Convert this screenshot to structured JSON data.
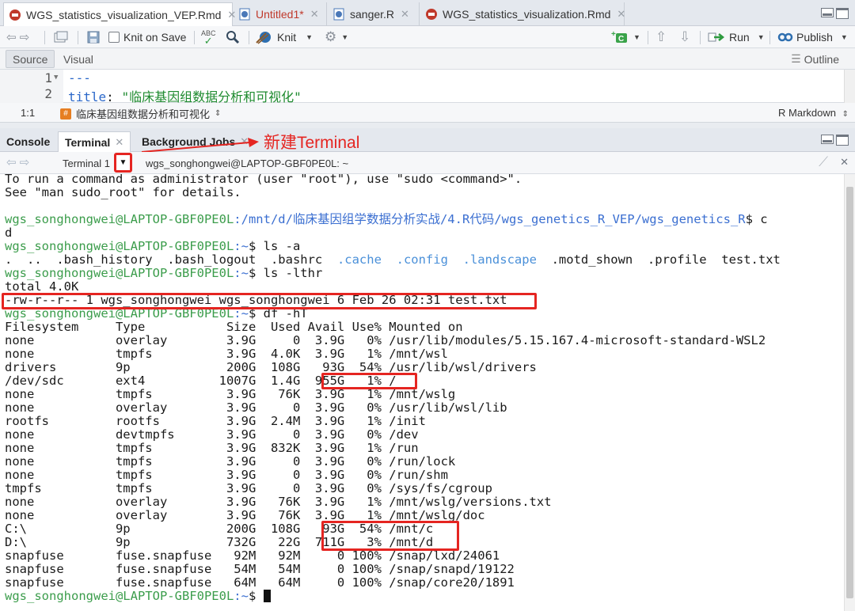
{
  "editor_tabs": [
    {
      "label": "WGS_statistics_visualization_VEP.Rmd",
      "icon": "rmd-file-icon",
      "active": true
    },
    {
      "label": "Untitled1*",
      "icon": "r-file-icon",
      "modified": true
    },
    {
      "label": "sanger.R",
      "icon": "r-file-icon"
    },
    {
      "label": "WGS_statistics_visualization.Rmd",
      "icon": "rmd-file-icon"
    }
  ],
  "toolbar": {
    "knit_on_save_label": "Knit on Save",
    "knit_label": "Knit",
    "run_label": "Run",
    "publish_label": "Publish",
    "spell_label": "ABC"
  },
  "editor_mode": {
    "source_label": "Source",
    "visual_label": "Visual",
    "outline_label": "Outline"
  },
  "code_lines": [
    {
      "num": "1",
      "text": "---"
    },
    {
      "num": "2",
      "key": "title",
      "sep": ": ",
      "value": "\"临床基因组数据分析和可视化\""
    }
  ],
  "status": {
    "position": "1:1",
    "doc_title": "临床基因组数据分析和可视化",
    "mode": "R Markdown"
  },
  "console_tabs": [
    {
      "label": "Console"
    },
    {
      "label": "Terminal",
      "active": true
    },
    {
      "label": "Background Jobs"
    }
  ],
  "annotation": "新建Terminal",
  "terminal": {
    "selector_label": "Terminal 1",
    "title": "wgs_songhongwei@LAPTOP-GBF0PE0L: ~",
    "prompt_user": "wgs_songhongwei@LAPTOP-GBF0PE0L",
    "lines": {
      "sudo1": "To run a command as administrator (user \"root\"), use \"sudo <command>\".",
      "sudo2": "See \"man sudo_root\" for details.",
      "p1_path": ":/mnt/d/临床基因组学数据分析实战/4.R代码/wgs_genetics_R_VEP/wgs_genetics_R",
      "p1_cmd": "$ c",
      "p1_wrap": "d",
      "p2_path": ":~",
      "p2_cmd": "$ ls -a",
      "ls_plain1": ".  ..  .bash_history  .bash_logout  .bashrc  ",
      "ls_cache": ".cache",
      "ls_config": ".config",
      "ls_landscape": ".landscape",
      "ls_plain2": "  .motd_shown  .profile  test.txt",
      "p3_cmd": "$ ls -lthr",
      "total": "total 4.0K",
      "file_line": "-rw-r--r-- 1 wgs_songhongwei wgs_songhongwei 6 Feb 26 02:31 test.txt",
      "p4_cmd": "$ df -hT",
      "df_header": "Filesystem     Type           Size  Used Avail Use% Mounted on",
      "p5_cmd": "$ "
    },
    "df_rows": [
      "none           overlay        3.9G     0  3.9G   0% /usr/lib/modules/5.15.167.4-microsoft-standard-WSL2",
      "none           tmpfs          3.9G  4.0K  3.9G   1% /mnt/wsl",
      "drivers        9p             200G  108G   93G  54% /usr/lib/wsl/drivers",
      "/dev/sdc       ext4          1007G  1.4G  955G   1% /",
      "none           tmpfs          3.9G   76K  3.9G   1% /mnt/wslg",
      "none           overlay        3.9G     0  3.9G   0% /usr/lib/wsl/lib",
      "rootfs         rootfs         3.9G  2.4M  3.9G   1% /init",
      "none           devtmpfs       3.9G     0  3.9G   0% /dev",
      "none           tmpfs          3.9G  832K  3.9G   1% /run",
      "none           tmpfs          3.9G     0  3.9G   0% /run/lock",
      "none           tmpfs          3.9G     0  3.9G   0% /run/shm",
      "tmpfs          tmpfs          3.9G     0  3.9G   0% /sys/fs/cgroup",
      "none           overlay        3.9G   76K  3.9G   1% /mnt/wslg/versions.txt",
      "none           overlay        3.9G   76K  3.9G   1% /mnt/wslg/doc",
      "C:\\            9p             200G  108G   93G  54% /mnt/c",
      "D:\\            9p             732G   22G  711G   3% /mnt/d",
      "snapfuse       fuse.snapfuse   92M   92M     0 100% /snap/lxd/24061",
      "snapfuse       fuse.snapfuse   54M   54M     0 100% /snap/snapd/19122",
      "snapfuse       fuse.snapfuse   64M   64M     0 100% /snap/core20/1891"
    ]
  },
  "colors": {
    "highlight": "#e52521",
    "prompt": "#3c9d4c",
    "path": "#3b6fd1",
    "directory": "#4a90d9"
  }
}
